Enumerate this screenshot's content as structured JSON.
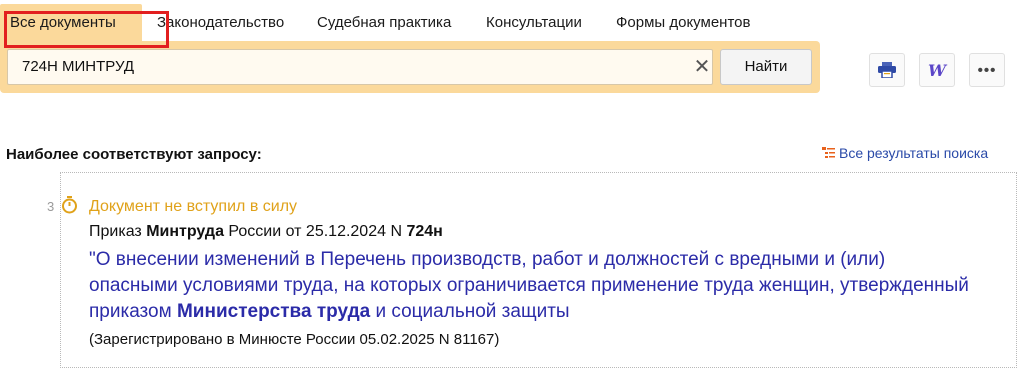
{
  "tabs": [
    {
      "label": "Все документы",
      "active": true
    },
    {
      "label": "Законодательство",
      "active": false
    },
    {
      "label": "Судебная практика",
      "active": false
    },
    {
      "label": "Консультации",
      "active": false
    },
    {
      "label": "Формы документов",
      "active": false
    }
  ],
  "search": {
    "value": "724Н МИНТРУД",
    "clear_icon": "close-icon",
    "button_label": "Найти"
  },
  "toolbar": {
    "print_icon": "print-icon",
    "word_icon": "word-export-icon",
    "word_glyph": "W",
    "more_icon": "more-icon",
    "more_glyph": "•••"
  },
  "results": {
    "heading": "Наиболее соответствуют запросу:",
    "all_results_label": "Все результаты поиска",
    "items": [
      {
        "rank": "3",
        "status": "Документ не вступил в силу",
        "doc_prefix": "Приказ ",
        "doc_issuer": "Минтруда",
        "doc_middle": " России от 25.12.2024 N ",
        "doc_number": "724н",
        "title_part1": "\"О внесении изменений в Перечень производств, работ и должностей с вредными и (или) опасными условиями труда, на которых ограничивается применение труда женщин, утвержденный приказом ",
        "title_bold": "Министерства труда",
        "title_part2": " и социальной защиты",
        "registration": "(Зарегистрировано в Минюсте России 05.02.2025 N 81167)"
      }
    ]
  },
  "colors": {
    "accent": "#fbd99b",
    "highlight": "#e21f1f",
    "link": "#2b2ba8",
    "status": "#e0a21a"
  }
}
